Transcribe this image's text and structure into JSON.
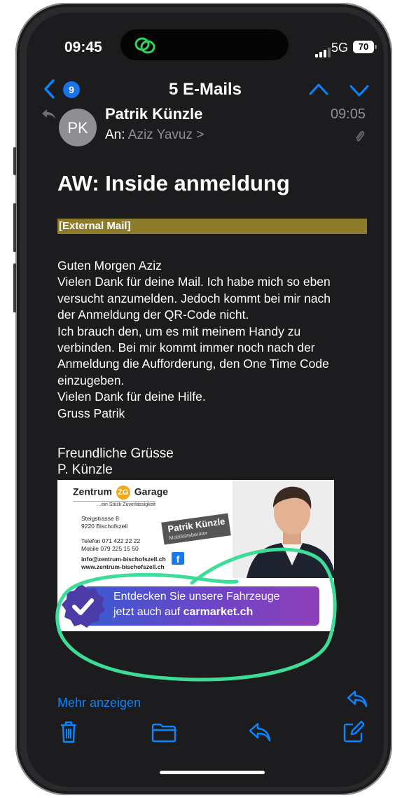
{
  "status_bar": {
    "time": "09:45",
    "network": "5G",
    "battery": "70",
    "app_icon": "wechat-icon"
  },
  "nav": {
    "unread_count": "9",
    "title": "5 E-Mails"
  },
  "message": {
    "avatar_initials": "PK",
    "sender": "Patrik Künzle",
    "to_label": "An:",
    "recipient": "Aziz Yavuz >",
    "time": "09:05",
    "subject": "AW: Inside anmeldung",
    "external_banner": "[External Mail]",
    "body_lines": [
      "Guten Morgen Aziz",
      "Vielen Dank für deine Mail. Ich habe mich so eben",
      "versucht anzumelden. Jedoch kommt bei mir nach",
      "der Anmeldung der QR-Code nicht.",
      "Ich brauch den, um es mit meinem Handy zu",
      "verbinden. Bei mir kommt immer noch nach der",
      "Anmeldung die Aufforderung, den One Time Code",
      "einzugeben.",
      "Vielen Dank für deine Hilfe.",
      "Gruss Patrik"
    ],
    "closing_1": "Freundliche Grüsse",
    "closing_2": "P. Künzle",
    "more_link": "Mehr anzeigen"
  },
  "card": {
    "logo_left": "Zentrum",
    "logo_badge": "ZG",
    "logo_right": "Garage",
    "tagline": "...ein Stück Zuverlässigkeit",
    "street": "Steigstrasse 8",
    "city": "9220 Bischofszell",
    "phone": "Telefon  071 422 22 22",
    "mobile": "Mobile  079 225 15 50",
    "email": "info@zentrum-bischofszell.ch",
    "website": "www.zentrum-bischofszell.ch",
    "person_name": "Patrik Künzle",
    "person_role": "Mobilitätsberater",
    "promo_line1": "Entdecken Sie unsere Fahrzeuge",
    "promo_line2_prefix": "jetzt auch auf ",
    "promo_line2_brand": "carmarket.ch"
  },
  "colors": {
    "accent": "#0a84ff",
    "background": "#1c1c1e",
    "external_banner": "#8d7b2c",
    "highlight_circle": "#3ddc97"
  },
  "toolbar": {
    "icons": [
      "trash-icon",
      "folder-icon",
      "reply-icon",
      "compose-icon"
    ]
  }
}
